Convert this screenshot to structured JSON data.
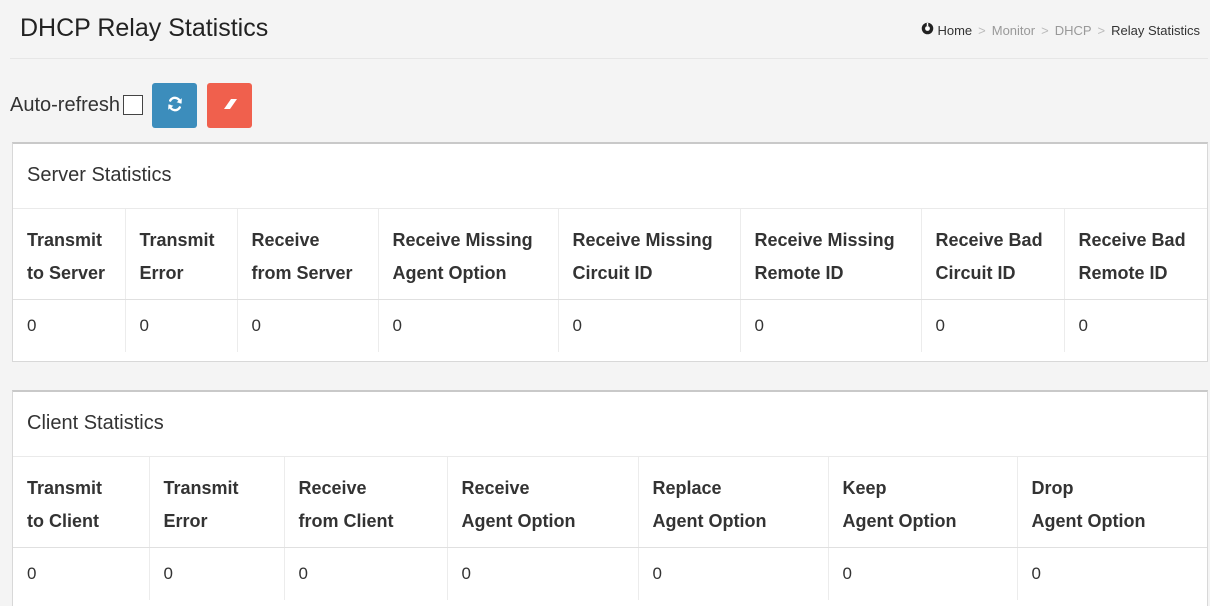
{
  "header": {
    "title": "DHCP Relay Statistics",
    "breadcrumb": [
      "Home",
      "Monitor",
      "DHCP",
      "Relay Statistics"
    ],
    "separator": ">"
  },
  "toolbar": {
    "auto_refresh_label": "Auto-refresh",
    "auto_refresh_checked": false,
    "refresh_icon": "refresh-icon",
    "clear_icon": "eraser-icon",
    "refresh_color": "#3c8dbc",
    "clear_color": "#f0604d"
  },
  "server": {
    "title": "Server Statistics",
    "headers": [
      [
        "Transmit",
        "to Server"
      ],
      [
        "Transmit",
        "Error"
      ],
      [
        "Receive",
        "from Server"
      ],
      [
        "Receive Missing",
        "Agent Option"
      ],
      [
        "Receive Missing",
        "Circuit ID"
      ],
      [
        "Receive Missing",
        "Remote ID"
      ],
      [
        "Receive Bad",
        "Circuit ID"
      ],
      [
        "Receive Bad",
        "Remote ID"
      ]
    ],
    "values": [
      "0",
      "0",
      "0",
      "0",
      "0",
      "0",
      "0",
      "0"
    ]
  },
  "client": {
    "title": "Client Statistics",
    "headers": [
      [
        "Transmit",
        "to Client"
      ],
      [
        "Transmit",
        "Error"
      ],
      [
        "Receive",
        "from Client"
      ],
      [
        "Receive",
        "Agent Option"
      ],
      [
        "Replace",
        "Agent Option"
      ],
      [
        "Keep",
        "Agent Option"
      ],
      [
        "Drop",
        "Agent Option"
      ]
    ],
    "values": [
      "0",
      "0",
      "0",
      "0",
      "0",
      "0",
      "0"
    ]
  }
}
